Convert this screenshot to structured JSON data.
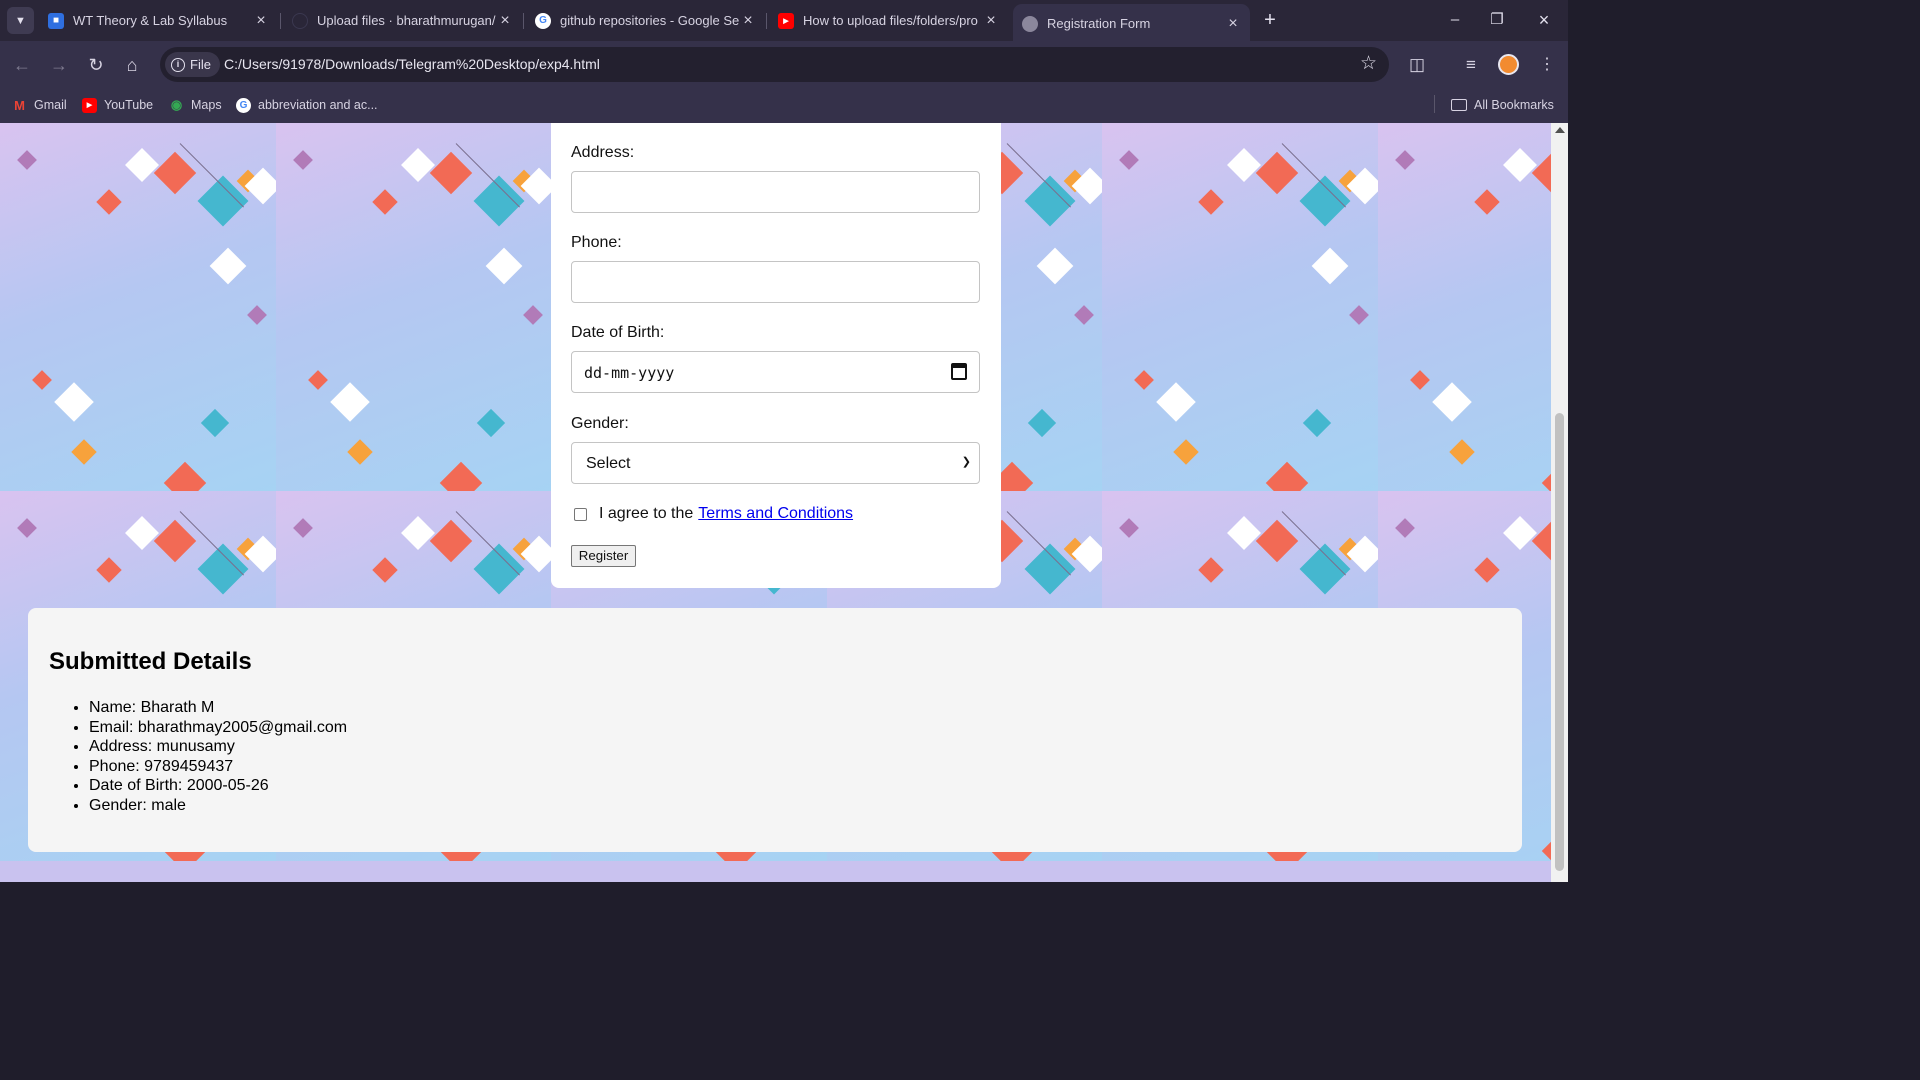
{
  "browser": {
    "tabs": [
      {
        "title": "WT Theory & Lab Syllabus",
        "icon": "google-sites-icon"
      },
      {
        "title": "Upload files · bharathmurugan/",
        "icon": "github-icon"
      },
      {
        "title": "github repositories - Google Se",
        "icon": "google-icon"
      },
      {
        "title": "How to upload files/folders/pro",
        "icon": "youtube-icon"
      },
      {
        "title": "Registration Form",
        "icon": "globe-icon"
      }
    ],
    "new_tab": "+",
    "address": {
      "chip": "File",
      "url": "C:/Users/91978/Downloads/Telegram%20Desktop/exp4.html"
    },
    "bookmarks": [
      {
        "label": "Gmail",
        "icon": "gmail-icon"
      },
      {
        "label": "YouTube",
        "icon": "youtube-icon"
      },
      {
        "label": "Maps",
        "icon": "maps-icon"
      },
      {
        "label": "abbreviation and ac...",
        "icon": "google-icon"
      }
    ],
    "all_bookmarks": "All Bookmarks"
  },
  "form": {
    "address_label": "Address:",
    "phone_label": "Phone:",
    "dob_label": "Date of Birth:",
    "dob_placeholder": "dd-mm-yyyy",
    "gender_label": "Gender:",
    "gender_selected": "Select",
    "agree_text": "I agree to the",
    "terms_link": "Terms and Conditions",
    "register_label": "Register"
  },
  "details": {
    "heading": "Submitted Details",
    "items": [
      "Name: Bharath M",
      "Email: bharathmay2005@gmail.com",
      "Address: munusamy",
      "Phone: 9789459437",
      "Date of Birth: 2000-05-26",
      "Gender: male"
    ]
  },
  "colors": {
    "chrome_dark": "#2a2638",
    "chrome_toolbar": "#35314a",
    "link": "#0000ee"
  }
}
